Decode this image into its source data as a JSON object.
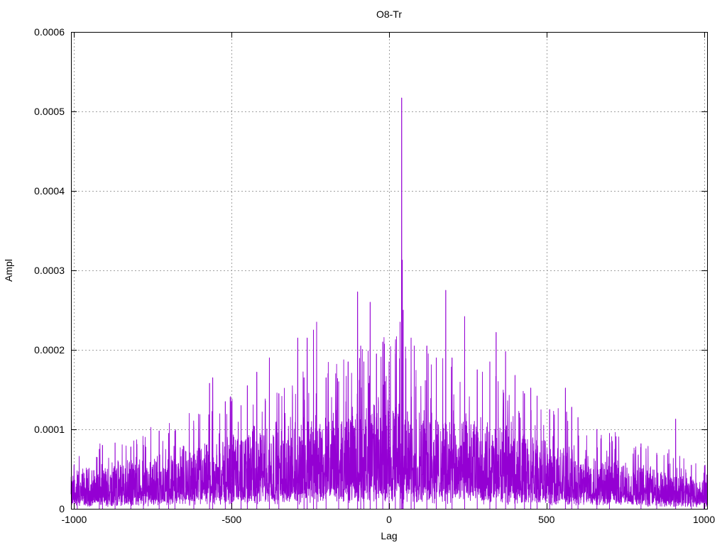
{
  "chart_data": {
    "type": "line",
    "title": "O8-Tr",
    "xlabel": "Lag",
    "ylabel": "Ampl",
    "xlim": [
      -1010,
      1010
    ],
    "ylim": [
      0,
      0.0006
    ],
    "xticks": [
      -1000,
      -500,
      0,
      500,
      1000
    ],
    "xtick_labels": [
      "-1000",
      "-500",
      "0",
      "500",
      "1000"
    ],
    "yticks": [
      0,
      0.0001,
      0.0002,
      0.0003,
      0.0004,
      0.0005,
      0.0006
    ],
    "ytick_labels": [
      "0",
      "0.0001",
      "0.0002",
      "0.0003",
      "0.0004",
      "0.0005",
      "0.0006"
    ],
    "grid": true,
    "legend": "none",
    "series_color": "#9400d3",
    "envelope_x": [
      -1010,
      -1000,
      -800,
      -600,
      -500,
      -300,
      -100,
      0,
      100,
      300,
      500,
      700,
      900,
      1000,
      1010
    ],
    "envelope_y": [
      2.5e-05,
      3e-05,
      4e-05,
      5e-05,
      6e-05,
      7e-05,
      8e-05,
      9e-05,
      8e-05,
      7e-05,
      5.5e-05,
      4e-05,
      3e-05,
      2.5e-05,
      2.5e-05
    ],
    "peaks": [
      {
        "x": -990,
        "y": 4e-05
      },
      {
        "x": -920,
        "y": 7.5e-05
      },
      {
        "x": -910,
        "y": 8e-05
      },
      {
        "x": -870,
        "y": 8.3e-05
      },
      {
        "x": -820,
        "y": 7.8e-05
      },
      {
        "x": -780,
        "y": 8e-05
      },
      {
        "x": -730,
        "y": 9.8e-05
      },
      {
        "x": -700,
        "y": 9.5e-05
      },
      {
        "x": -680,
        "y": 9.8e-05
      },
      {
        "x": -620,
        "y": 0.0001
      },
      {
        "x": -570,
        "y": 0.000158
      },
      {
        "x": -560,
        "y": 0.000165
      },
      {
        "x": -520,
        "y": 0.000135
      },
      {
        "x": -500,
        "y": 0.000135
      },
      {
        "x": -470,
        "y": 0.00013
      },
      {
        "x": -450,
        "y": 0.000155
      },
      {
        "x": -420,
        "y": 0.000172
      },
      {
        "x": -380,
        "y": 0.00019
      },
      {
        "x": -350,
        "y": 0.000145
      },
      {
        "x": -290,
        "y": 0.000215
      },
      {
        "x": -270,
        "y": 0.000165
      },
      {
        "x": -260,
        "y": 0.000215
      },
      {
        "x": -240,
        "y": 0.000225
      },
      {
        "x": -230,
        "y": 0.000235
      },
      {
        "x": -200,
        "y": 0.000165
      },
      {
        "x": -160,
        "y": 0.00016
      },
      {
        "x": -130,
        "y": 0.000185
      },
      {
        "x": -100,
        "y": 0.000273
      },
      {
        "x": -90,
        "y": 0.000205
      },
      {
        "x": -80,
        "y": 0.000185
      },
      {
        "x": -60,
        "y": 0.00026
      },
      {
        "x": -40,
        "y": 0.000195
      },
      {
        "x": -20,
        "y": 0.00021
      },
      {
        "x": 0,
        "y": 0.000185
      },
      {
        "x": 20,
        "y": 0.000195
      },
      {
        "x": 35,
        "y": 0.000235
      },
      {
        "x": 40,
        "y": 0.000517
      },
      {
        "x": 42,
        "y": 0.000313
      },
      {
        "x": 45,
        "y": 0.00025
      },
      {
        "x": 70,
        "y": 0.000215
      },
      {
        "x": 80,
        "y": 0.000205
      },
      {
        "x": 120,
        "y": 0.000205
      },
      {
        "x": 150,
        "y": 0.00019
      },
      {
        "x": 180,
        "y": 0.000275
      },
      {
        "x": 200,
        "y": 0.00019
      },
      {
        "x": 240,
        "y": 0.000242
      },
      {
        "x": 280,
        "y": 0.000175
      },
      {
        "x": 320,
        "y": 0.000185
      },
      {
        "x": 340,
        "y": 0.000222
      },
      {
        "x": 370,
        "y": 0.000198
      },
      {
        "x": 400,
        "y": 0.000168
      },
      {
        "x": 430,
        "y": 0.000145
      },
      {
        "x": 450,
        "y": 0.000152
      },
      {
        "x": 470,
        "y": 0.000142
      },
      {
        "x": 510,
        "y": 0.000125
      },
      {
        "x": 560,
        "y": 0.000152
      },
      {
        "x": 580,
        "y": 0.000128
      },
      {
        "x": 600,
        "y": 0.000115
      },
      {
        "x": 660,
        "y": 0.0001
      },
      {
        "x": 700,
        "y": 9.5e-05
      },
      {
        "x": 800,
        "y": 8.2e-05
      },
      {
        "x": 850,
        "y": 7e-05
      },
      {
        "x": 910,
        "y": 0.000113
      },
      {
        "x": 960,
        "y": 5.5e-05
      },
      {
        "x": 1000,
        "y": 4.5e-05
      }
    ]
  }
}
